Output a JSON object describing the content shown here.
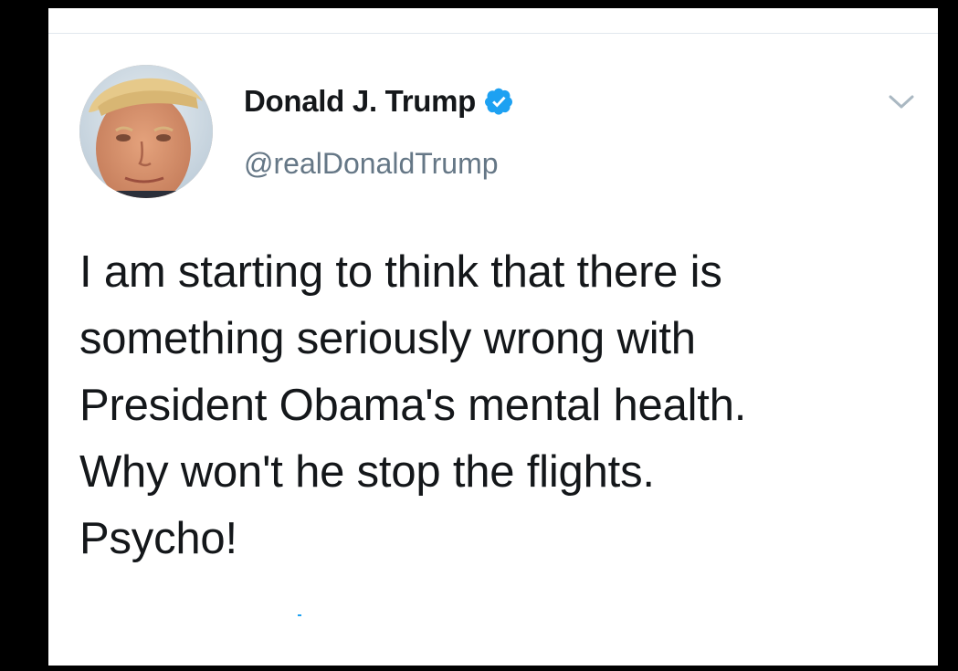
{
  "tweet": {
    "author_name": "Donald J. Trump",
    "handle": "@realDonaldTrump",
    "verified": true,
    "text": "I am starting to think that there is\nsomething seriously wrong with\nPresident Obama's mental health.\nWhy won't he stop the flights.\nPsycho!"
  },
  "icons": {
    "verified": "verified-badge-icon",
    "menu": "chevron-down-icon"
  },
  "colors": {
    "name_text": "#14171a",
    "handle_text": "#657786",
    "verified_blue": "#1da1f2",
    "chevron": "#aab8c2",
    "background": "#ffffff",
    "outer_border": "#000000"
  }
}
